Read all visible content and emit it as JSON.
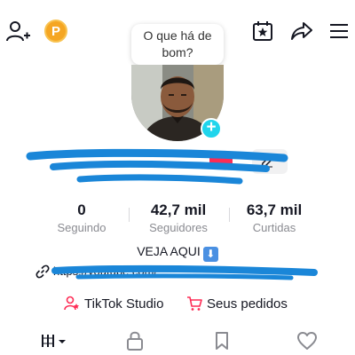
{
  "top_bar": {
    "coin_label": "P",
    "icons": [
      "add-friend-icon",
      "coin-icon",
      "calendar-star-icon",
      "share-icon",
      "menu-icon"
    ]
  },
  "bubble": {
    "text": "O que há de bom?"
  },
  "stats": [
    {
      "value": "0",
      "label": "Seguindo"
    },
    {
      "value": "42,7 mil",
      "label": "Seguidores"
    },
    {
      "value": "63,7 mil",
      "label": "Curtidas"
    }
  ],
  "bio": {
    "text": "VEJA AQUI",
    "arrow": "⬇"
  },
  "link": {
    "text": "https://youtube.com/..."
  },
  "actions": {
    "studio_label": "TikTok Studio",
    "orders_label": "Seus pedidos"
  },
  "colors": {
    "accent_cyan": "#20d5ec",
    "tiktok_red": "#fe2c55",
    "coin": "#f5a623",
    "scribble_blue": "#1a86d8"
  }
}
